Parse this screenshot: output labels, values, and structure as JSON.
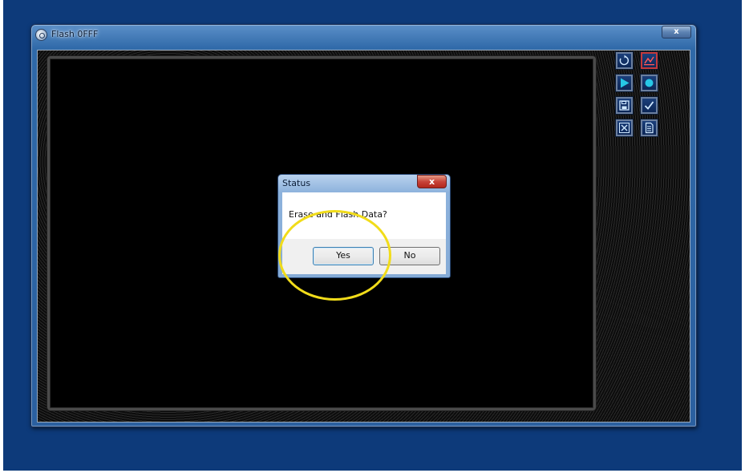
{
  "main_window": {
    "title": "Flash 0FFF",
    "close_label": "x"
  },
  "toolbar": [
    {
      "icon": "refresh-icon",
      "color": "#1f9fd6"
    },
    {
      "icon": "waveform-icon",
      "color": "#d93636"
    },
    {
      "icon": "play-icon",
      "color": "#21b8d8"
    },
    {
      "icon": "record-icon",
      "color": "#21b8d8"
    },
    {
      "icon": "save-icon",
      "color": "#1f9fd6"
    },
    {
      "icon": "checkmark-icon",
      "color": "#1f9fd6"
    },
    {
      "icon": "close-x-icon",
      "color": "#1f9fd6"
    },
    {
      "icon": "document-icon",
      "color": "#1f9fd6"
    }
  ],
  "dialog": {
    "title": "Status",
    "close_label": "x",
    "message": "Erase and Flash Data?",
    "yes_label": "Yes",
    "no_label": "No"
  },
  "annotation": {
    "highlight_color": "#f1dc1a"
  }
}
